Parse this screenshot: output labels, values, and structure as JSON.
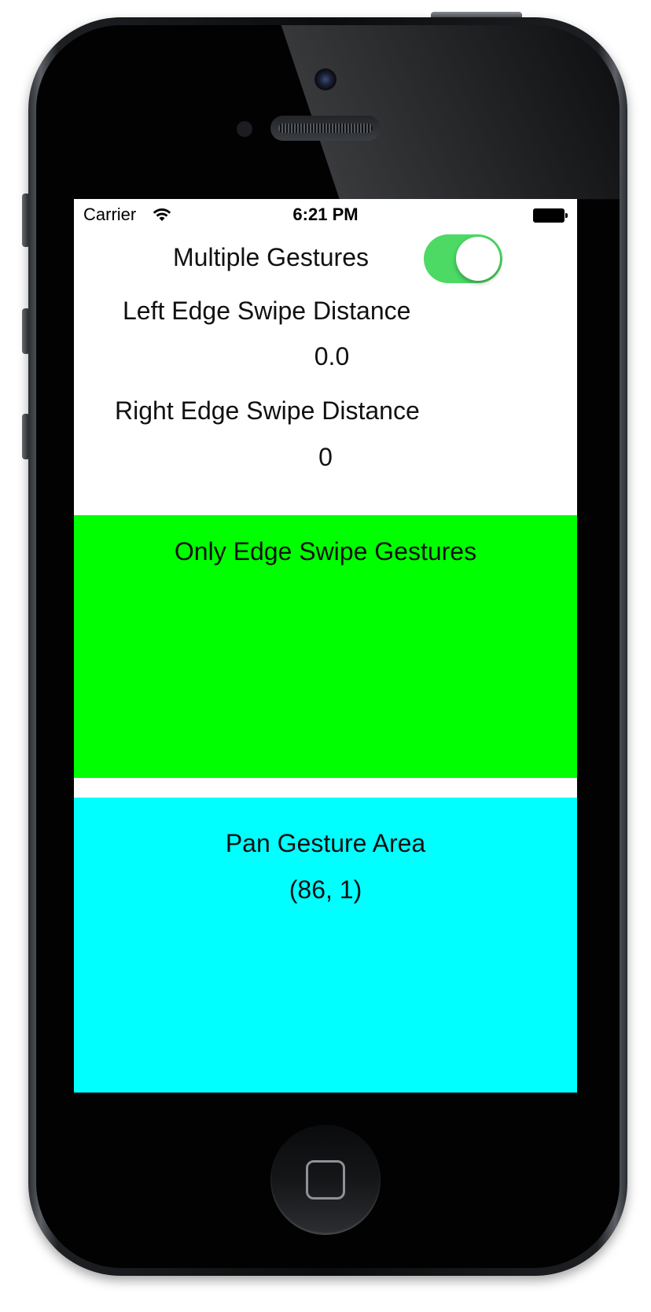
{
  "status_bar": {
    "carrier": "Carrier",
    "time": "6:21 PM"
  },
  "controls": {
    "multiple_gestures_label": "Multiple Gestures",
    "multiple_gestures_on": true,
    "toggle_on_color": "#4cd964"
  },
  "left_edge": {
    "label": "Left Edge Swipe Distance",
    "value": "0.0"
  },
  "right_edge": {
    "label": "Right Edge Swipe Distance",
    "value": "0"
  },
  "edge_area": {
    "title": "Only Edge Swipe Gestures",
    "color": "#00ff00"
  },
  "pan_area": {
    "title": "Pan Gesture Area",
    "coordinates": "(86, 1)",
    "color": "#00ffff"
  }
}
